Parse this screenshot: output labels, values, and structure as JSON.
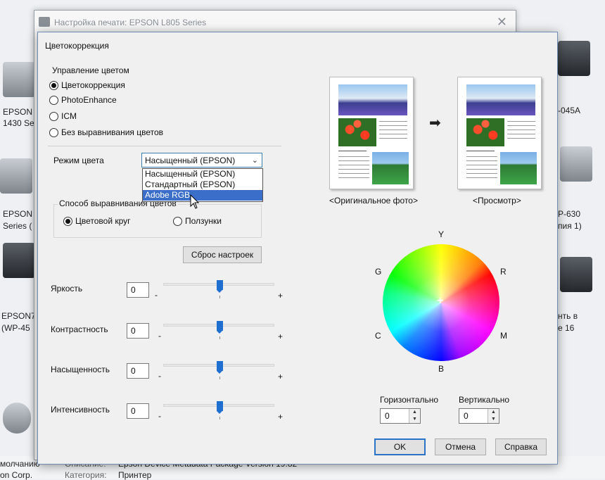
{
  "background": {
    "texts": [
      "EPSON",
      "1430 Se",
      "EPSON",
      "Series (",
      "EPSON7",
      "(WP-45",
      "-045A",
      "P-630",
      "пия 1)",
      "нть в",
      "е 16",
      "молчанию",
      "Описание:",
      "Epson Device Metadata Package Version 19.82",
      "on Corp.",
      "Категория:",
      "Принтер"
    ]
  },
  "parent_window": {
    "title": "Настройка печати: EPSON L805 Series"
  },
  "dialog": {
    "title": "Цветокоррекция",
    "color_management": {
      "legend": "Управление цветом",
      "options": [
        "Цветокоррекция",
        "PhotoEnhance",
        "ICM",
        "Без выравнивания цветов"
      ],
      "selected": "Цветокоррекция"
    },
    "color_mode": {
      "label": "Режим цвета",
      "value": "Насыщенный (EPSON)",
      "options": [
        "Насыщенный (EPSON)",
        "Стандартный (EPSON)",
        "Adobe RGB"
      ],
      "highlighted": "Adobe RGB"
    },
    "color_alignment": {
      "legend": "Способ выравнивания цветов",
      "options": [
        "Цветовой круг",
        "Ползунки"
      ],
      "selected": "Цветовой круг"
    },
    "reset_label": "Сброс настроек",
    "sliders": [
      {
        "label": "Яркость",
        "value": "0",
        "minus": "-",
        "plus": "+"
      },
      {
        "label": "Контрастность",
        "value": "0",
        "minus": "-",
        "plus": "+"
      },
      {
        "label": "Насыщенность",
        "value": "0",
        "minus": "-",
        "plus": "+"
      },
      {
        "label": "Интенсивность",
        "value": "0",
        "minus": "-",
        "plus": "+"
      }
    ],
    "preview": {
      "original_caption": "<Оригинальное фото>",
      "preview_caption": "<Просмотр>"
    },
    "color_wheel": {
      "labels": {
        "top": "Y",
        "right_top": "R",
        "right_bottom": "M",
        "bottom": "B",
        "left_bottom": "C",
        "left_top": "G"
      },
      "center_mark": "+"
    },
    "horizontal": {
      "label": "Горизонтально",
      "value": "0"
    },
    "vertical": {
      "label": "Вертикально",
      "value": "0"
    },
    "buttons": {
      "ok": "OK",
      "cancel": "Отмена",
      "help": "Справка"
    }
  }
}
